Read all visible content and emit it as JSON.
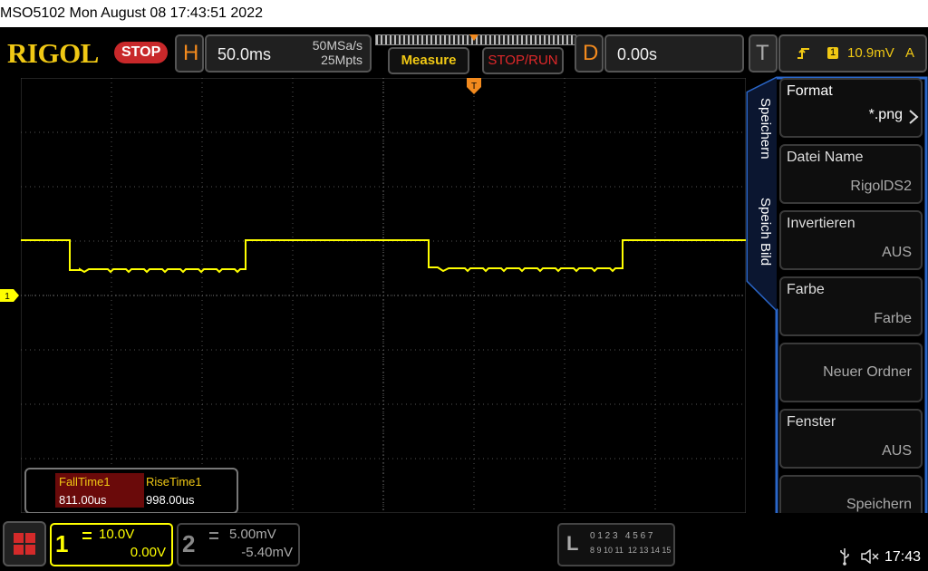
{
  "window": {
    "title": "MSO5102  Mon August 08 17:43:51 2022"
  },
  "header": {
    "logo": "RIGOL",
    "run_state": "STOP",
    "horizontal": {
      "letter": "H",
      "timebase": "50.0ms",
      "sample_rate": "50MSa/s",
      "memory_depth": "25Mpts"
    },
    "measure_label": "Measure",
    "stop_run_label": "STOP/RUN",
    "delay": {
      "letter": "D",
      "value": "0.00s"
    },
    "trigger": {
      "letter": "T",
      "channel_badge": "1",
      "level": "10.9mV",
      "mode": "A"
    }
  },
  "waveform": {
    "channel_marker": "1",
    "trigger_marker": "T",
    "trace_color": "#ffff00"
  },
  "measurements": {
    "headers": [
      "FallTime1",
      "RiseTime1"
    ],
    "values": [
      "811.00us",
      "998.00us"
    ]
  },
  "side_menu": {
    "tabs": [
      "Speichern",
      "Speich Bild"
    ],
    "items": [
      {
        "title": "Format",
        "value": "*.png",
        "active": true
      },
      {
        "title": "Datei Name",
        "value": "RigolDS2"
      },
      {
        "title": "Invertieren",
        "value": "AUS"
      },
      {
        "title": "Farbe",
        "value": "Farbe"
      },
      {
        "title": "",
        "value": "Neuer Ordner"
      },
      {
        "title": "Fenster",
        "value": "AUS"
      },
      {
        "title": "",
        "value": "Speichern"
      }
    ]
  },
  "channels": [
    {
      "number": "1",
      "scale": "10.0V",
      "offset": "0.00V",
      "color": "#ffff00"
    },
    {
      "number": "2",
      "scale": "5.00mV",
      "offset": "-5.40mV",
      "color": "#888888"
    }
  ],
  "logic": {
    "letter": "L",
    "row1": "0 1 2 3   4 5 6 7",
    "row2": "8 9 10 11  12 13 14 15"
  },
  "status": {
    "usb_icon": "usb-icon",
    "sound_icon": "speaker-muted-icon",
    "time": "17:43"
  }
}
